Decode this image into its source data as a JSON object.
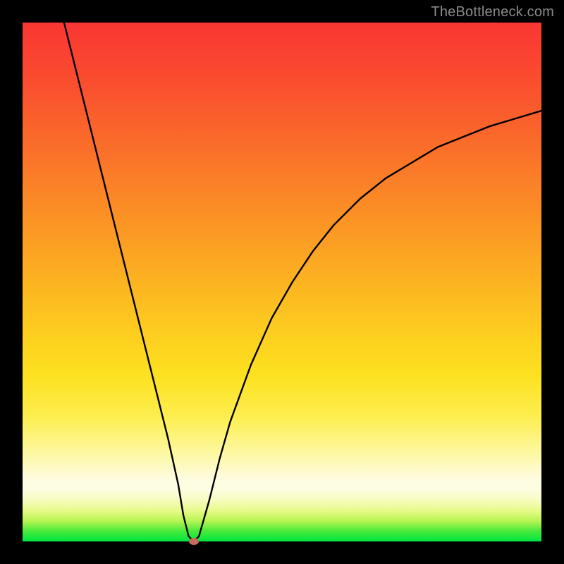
{
  "watermark": "TheBottleneck.com",
  "colors": {
    "background": "#000000",
    "curve": "#000000",
    "marker": "#c76a5d",
    "gradient_top": "#f93633",
    "gradient_bottom": "#00e53f"
  },
  "chart_data": {
    "type": "line",
    "title": "",
    "xlabel": "",
    "ylabel": "",
    "xlim": [
      0,
      100
    ],
    "ylim": [
      0,
      100
    ],
    "grid": false,
    "legend": false,
    "series": [
      {
        "name": "bottleneck-curve",
        "x": [
          8,
          10,
          12,
          14,
          16,
          18,
          20,
          22,
          24,
          26,
          28,
          30,
          31,
          32,
          33,
          34,
          36,
          38,
          40,
          44,
          48,
          52,
          56,
          60,
          65,
          70,
          75,
          80,
          85,
          90,
          95,
          100
        ],
        "y": [
          100,
          92,
          84,
          76,
          68,
          60,
          52,
          44,
          36,
          28,
          20,
          11,
          5,
          1,
          0,
          1,
          8,
          16,
          23,
          34,
          43,
          50,
          56,
          61,
          66,
          70,
          73,
          76,
          78,
          80,
          81.5,
          83
        ]
      }
    ],
    "marker": {
      "x": 33,
      "y": 0
    },
    "notes": "V-shaped curve on a full-bleed vertical rainbow gradient (green at bottom → red at top). Small reddish-brown elliptical marker at the curve's minimum near x≈33. No visible axes, ticks, or labels — only the rainbow panel, the black curve, and a watermark."
  }
}
